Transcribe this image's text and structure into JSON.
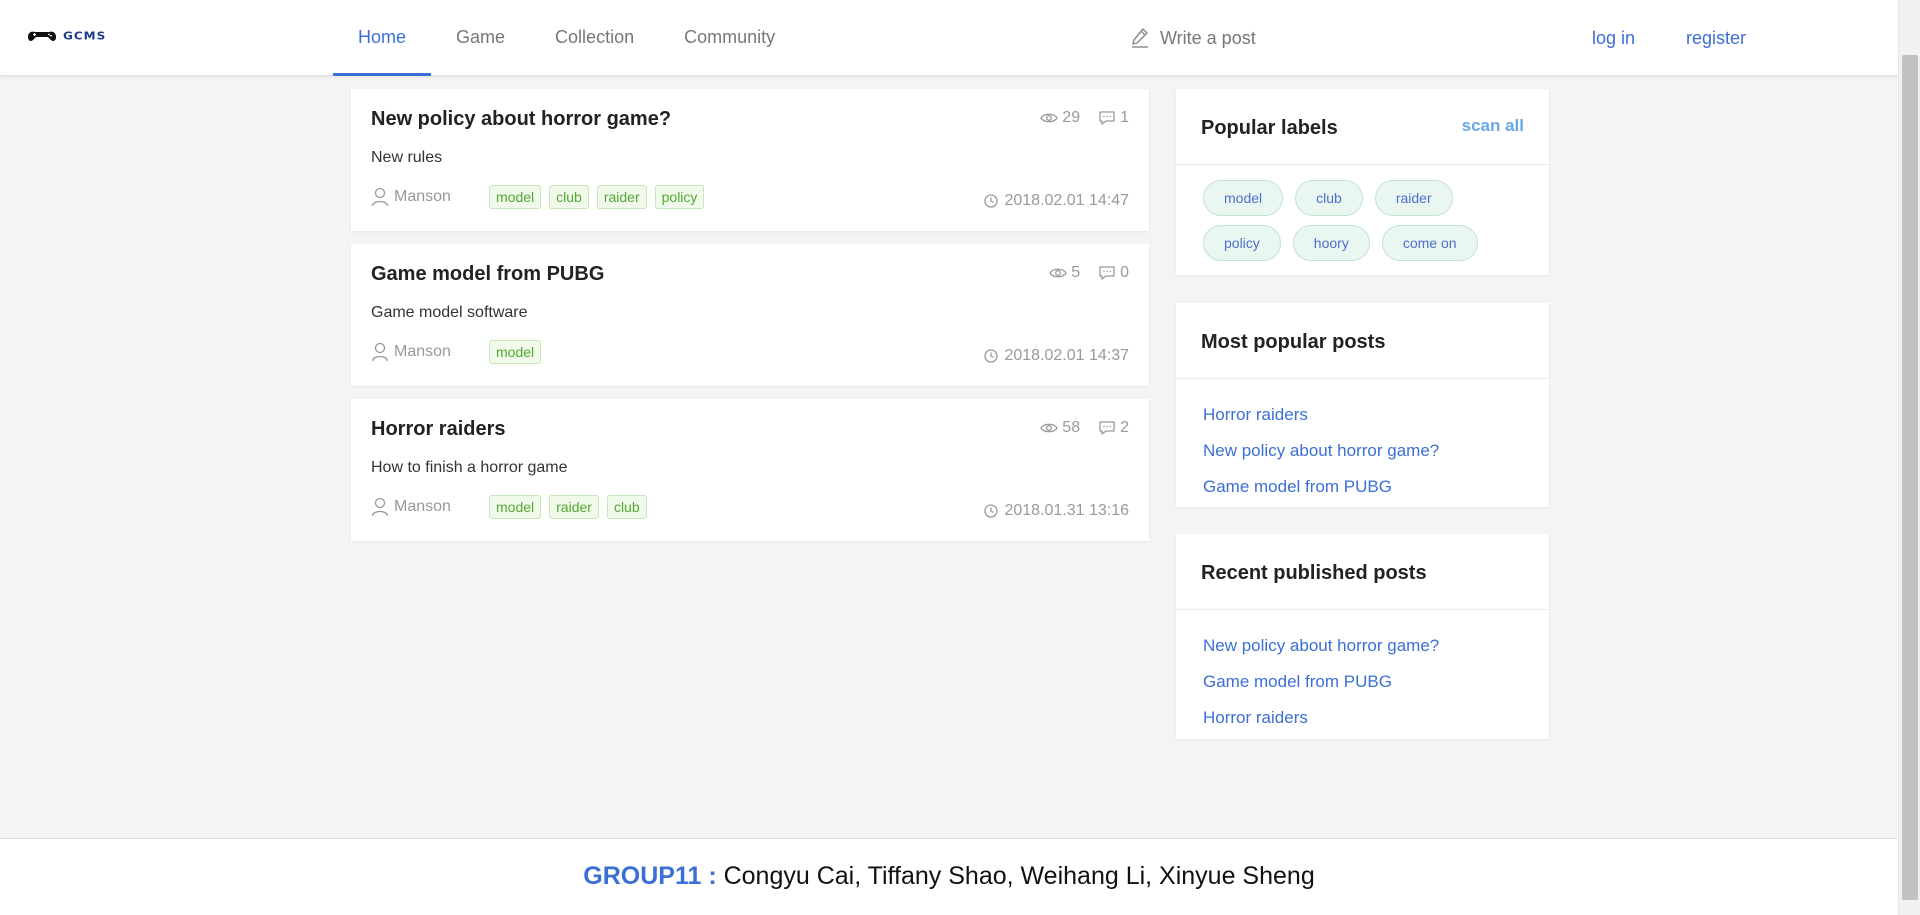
{
  "header": {
    "logo_text": "GCMS",
    "nav": [
      {
        "label": "Home",
        "active": true
      },
      {
        "label": "Game",
        "active": false
      },
      {
        "label": "Collection",
        "active": false
      },
      {
        "label": "Community",
        "active": false
      }
    ],
    "write_post": "Write a post",
    "login": "log in",
    "register": "register",
    "accent_color": "#3c6fd6"
  },
  "posts": [
    {
      "title": "New policy about horror game?",
      "views": "29",
      "comments": "1",
      "description": "New rules",
      "author": "Manson",
      "tags": [
        "model",
        "club",
        "raider",
        "policy"
      ],
      "date": "2018.02.01 14:47"
    },
    {
      "title": "Game model from PUBG",
      "views": "5",
      "comments": "0",
      "description": "Game model software",
      "author": "Manson",
      "tags": [
        "model"
      ],
      "date": "2018.02.01 14:37"
    },
    {
      "title": "Horror raiders",
      "views": "58",
      "comments": "2",
      "description": "How to finish a horror game",
      "author": "Manson",
      "tags": [
        "model",
        "raider",
        "club"
      ],
      "date": "2018.01.31 13:16"
    }
  ],
  "sidebar": {
    "popular_labels": {
      "title": "Popular labels",
      "scan_all": "scan all",
      "labels": [
        "model",
        "club",
        "raider",
        "policy",
        "hoory",
        "come on"
      ]
    },
    "most_popular": {
      "title": "Most popular posts",
      "items": [
        "Horror raiders",
        "New policy about horror game?",
        "Game model from PUBG"
      ]
    },
    "recent": {
      "title": "Recent published posts",
      "items": [
        "New policy about horror game?",
        "Game model from PUBG",
        "Horror raiders"
      ]
    }
  },
  "footer": {
    "group": "GROUP11 :",
    "members": "Congyu Cai, Tiffany Shao, Weihang Li, Xinyue Sheng"
  },
  "icons": {
    "logo": "gamepad-logo-icon",
    "write": "pencil-icon",
    "views": "eye-icon",
    "comments": "comment-icon",
    "author": "user-icon",
    "date": "clock-icon"
  }
}
